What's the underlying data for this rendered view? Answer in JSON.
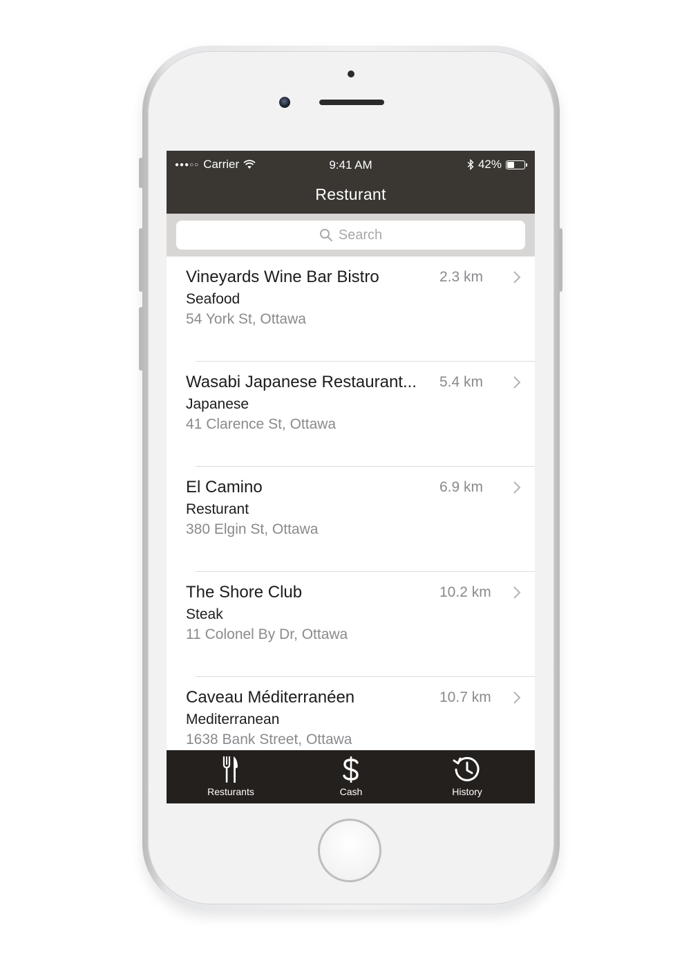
{
  "status_bar": {
    "signal": "●●●○○",
    "carrier": "Carrier",
    "time": "9:41 AM",
    "battery_percent": "42%",
    "battery_level": 0.42
  },
  "nav": {
    "title": "Resturant"
  },
  "search": {
    "placeholder": "Search"
  },
  "restaurants": [
    {
      "name": "Vineyards Wine Bar Bistro",
      "type": "Seafood",
      "address": "54 York St, Ottawa",
      "distance": "2.3 km"
    },
    {
      "name": "Wasabi Japanese Restaurant...",
      "type": "Japanese",
      "address": "41 Clarence St, Ottawa",
      "distance": "5.4 km"
    },
    {
      "name": "El Camino",
      "type": "Resturant",
      "address": "380 Elgin St, Ottawa",
      "distance": "6.9 km"
    },
    {
      "name": "The Shore Club",
      "type": "Steak",
      "address": "11 Colonel By Dr, Ottawa",
      "distance": "10.2 km"
    },
    {
      "name": "Caveau Méditerranéen",
      "type": "Mediterranean",
      "address": "1638 Bank Street, Ottawa",
      "distance": "10.7 km"
    }
  ],
  "tabs": [
    {
      "label": "Resturants",
      "icon": "fork-knife-icon"
    },
    {
      "label": "Cash",
      "icon": "dollar-icon"
    },
    {
      "label": "History",
      "icon": "history-clock-icon"
    }
  ],
  "colors": {
    "nav_bg": "#3a3632",
    "tab_bg": "#24201e",
    "search_bg": "#d8d6d4",
    "secondary_text": "#8a8a8e"
  }
}
